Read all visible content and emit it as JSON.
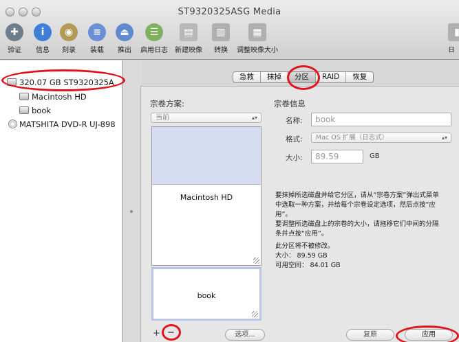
{
  "window": {
    "title": "ST9320325ASG Media"
  },
  "toolbar": {
    "items": [
      {
        "label": "验证",
        "icon": "microscope-icon",
        "glyph": "✚",
        "color": "#6c7d8c"
      },
      {
        "label": "信息",
        "icon": "info-icon",
        "glyph": "i",
        "color": "#3f7fd7"
      },
      {
        "label": "刻录",
        "icon": "burn-disc-icon",
        "glyph": "◉",
        "color": "#b59a55"
      },
      {
        "label": "装载",
        "icon": "mount-icon",
        "glyph": "≡",
        "color": "#6a8fd6"
      },
      {
        "label": "推出",
        "icon": "eject-icon",
        "glyph": "⏏",
        "color": "#5f8ad0"
      },
      {
        "label": "启用日志",
        "icon": "log-icon",
        "glyph": "☰",
        "color": "#7fb060"
      },
      {
        "label": "新建映像",
        "icon": "new-image-icon",
        "glyph": "▤",
        "color": "#b8b8b8"
      },
      {
        "label": "转换",
        "icon": "convert-icon",
        "glyph": "▥",
        "color": "#b0b0b0"
      },
      {
        "label": "调整映像大小",
        "icon": "resize-image-icon",
        "glyph": "▦",
        "color": "#b0b0b0"
      },
      {
        "label": "日",
        "icon": "log-window-icon",
        "glyph": "▮",
        "color": "#b0b0b0"
      }
    ]
  },
  "sidebar": {
    "disk": "320.07 GB ST9320325A",
    "volumes": [
      "Macintosh HD",
      "book"
    ],
    "optical": "MATSHITA DVD-R UJ-898"
  },
  "tabs": [
    "急救",
    "抹掉",
    "分区",
    "RAID",
    "恢复"
  ],
  "selected_tab": "分区",
  "scheme": {
    "title": "宗卷方案:",
    "popup_value": "当前",
    "volumes": [
      "Macintosh HD",
      "book"
    ]
  },
  "volume_info": {
    "title": "宗卷信息",
    "name_label": "名称:",
    "name_value": "book",
    "format_label": "格式:",
    "format_value": "Mac OS 扩展（日志式）",
    "size_label": "大小:",
    "size_value": "89.59",
    "size_unit": "GB"
  },
  "description": {
    "line1": "要抹掉所选磁盘并给它分区，请从“宗卷方案”弹出式菜单",
    "line2": "中选取一种方案，并给每个宗卷设定选项，然后点按“应",
    "line3": "用”。",
    "line4": "要调整所选磁盘上的宗卷的大小，请拖移它们中间的分隔",
    "line5": "条并点按“应用”。",
    "line6": "此分区将不被修改。",
    "size_line": "大小：  89.59 GB",
    "free_line": "可用空间：  84.01 GB"
  },
  "buttons": {
    "add": "+",
    "remove": "−",
    "options": "选项...",
    "revert": "复原",
    "apply": "应用"
  },
  "colors": {
    "annotation_red": "#e0141c",
    "volume_selected": "#d6dcf2"
  }
}
